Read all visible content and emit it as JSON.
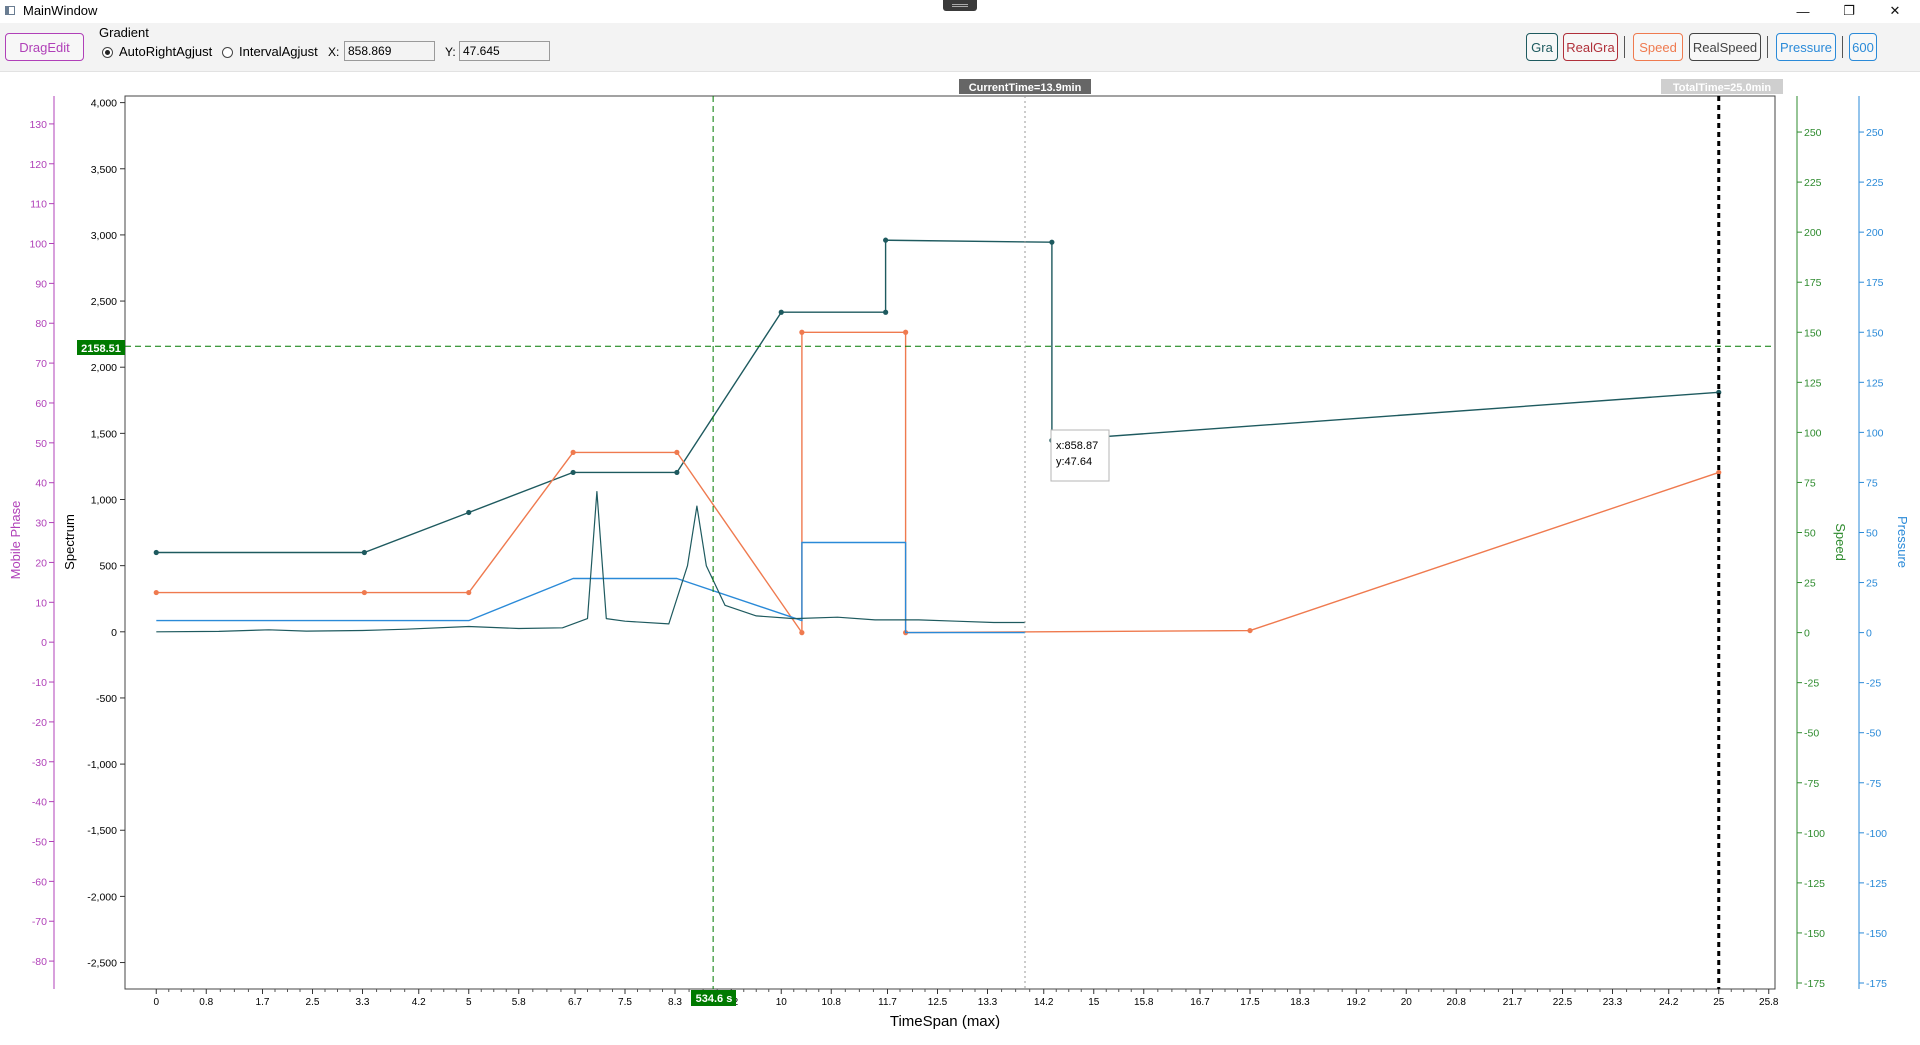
{
  "window": {
    "title": "MainWindow",
    "controls": {
      "minimize": "—",
      "maximize": "❐",
      "close": "✕"
    }
  },
  "toolbar": {
    "drag_edit": "DragEdit",
    "gradient_label": "Gradient",
    "auto_right_label": "AutoRightAgjust",
    "interval_label": "IntervalAgjust",
    "selected_mode": "AutoRightAgjust",
    "x_label": "X:",
    "x_value": "858.869",
    "y_label": "Y:",
    "y_value": "47.645",
    "right_buttons": {
      "gra": "Gra",
      "realgra": "RealGra",
      "speed": "Speed",
      "realspeed": "RealSpeed",
      "pressure": "Pressure",
      "n600": "600"
    }
  },
  "colors": {
    "gra": "#1e5a5f",
    "realgra": "#b0303a",
    "speed": "#ef7a4f",
    "realspeed": "#444444",
    "pressure": "#2a8ad8",
    "mobile_phase_axis": "#b040b8",
    "speed_axis": "#2e8b2e",
    "marker_green": "#007a00"
  },
  "chart": {
    "current_time_label": "CurrentTime=13.9min",
    "total_time_label": "TotalTime=25.0min",
    "y_marker_label": "2158.51",
    "x_marker_label": "534.6 s",
    "tooltip_x": "x:858.87",
    "tooltip_y": "y:47.64",
    "xlabel": "TimeSpan (max)",
    "axis_titles": {
      "mobile_phase": "Mobile Phase",
      "spectrum": "Spectrum",
      "speed": "Speed",
      "pressure": "Pressure"
    }
  },
  "chart_data": {
    "type": "line",
    "x_ticks": [
      "0",
      "0.8",
      "1.7",
      "2.5",
      "3.3",
      "4.2",
      "5",
      "5.8",
      "6.7",
      "7.5",
      "8.3",
      "9.2",
      "10",
      "10.8",
      "11.7",
      "12.5",
      "13.3",
      "14.2",
      "15",
      "15.8",
      "16.7",
      "17.5",
      "18.3",
      "19.2",
      "20",
      "20.8",
      "21.7",
      "22.5",
      "23.3",
      "24.2",
      "25",
      "25.8"
    ],
    "xlim": [
      -0.5,
      25.9
    ],
    "spectrum_axis": {
      "ylim": [
        -2700,
        4050
      ],
      "ticks": [
        "4,000",
        "3,500",
        "3,000",
        "2,500",
        "2,000",
        "1,500",
        "1,000",
        "500",
        "0",
        "-500",
        "-1,000",
        "-1,500",
        "-2,000",
        "-2,500"
      ]
    },
    "mobile_phase_axis": {
      "ylim": [
        -87,
        137
      ],
      "ticks": [
        "130",
        "120",
        "110",
        "100",
        "90",
        "80",
        "70",
        "60",
        "50",
        "40",
        "30",
        "20",
        "10",
        "0",
        "-10",
        "-20",
        "-30",
        "-40",
        "-50",
        "-60",
        "-70",
        "-80"
      ]
    },
    "speed_axis": {
      "ylim": [
        -178,
        268
      ],
      "ticks": [
        "250",
        "225",
        "200",
        "175",
        "150",
        "125",
        "100",
        "75",
        "50",
        "25",
        "0",
        "-25",
        "-50",
        "-75",
        "-100",
        "-125",
        "-150",
        "-175"
      ]
    },
    "pressure_axis": {
      "ylim": [
        -178,
        268
      ],
      "ticks": [
        "250",
        "225",
        "200",
        "175",
        "150",
        "125",
        "100",
        "75",
        "50",
        "25",
        "0",
        "-25",
        "-50",
        "-75",
        "-100",
        "-125",
        "-150",
        "-175"
      ]
    },
    "current_time": 13.9,
    "total_time": 25.0,
    "x_marker": 8.91,
    "y_marker": 2158.51,
    "series": [
      {
        "name": "Gra",
        "axis": "speed",
        "points": [
          [
            0,
            40
          ],
          [
            3.33,
            40
          ],
          [
            5,
            60
          ],
          [
            6.67,
            80
          ],
          [
            8.33,
            80
          ],
          [
            10,
            160
          ],
          [
            11.67,
            160
          ],
          [
            11.67,
            196
          ],
          [
            14.33,
            195
          ],
          [
            14.33,
            96
          ],
          [
            25,
            120
          ]
        ]
      },
      {
        "name": "Speed",
        "axis": "speed",
        "points": [
          [
            0,
            20
          ],
          [
            3.33,
            20
          ],
          [
            5,
            20
          ],
          [
            6.67,
            90
          ],
          [
            8.33,
            90
          ],
          [
            10.33,
            0
          ],
          [
            10.33,
            150
          ],
          [
            11.99,
            150
          ],
          [
            11.99,
            0
          ],
          [
            17.5,
            1
          ],
          [
            25,
            80
          ]
        ]
      },
      {
        "name": "Pressure",
        "axis": "pressure",
        "points": [
          [
            0,
            6
          ],
          [
            5,
            6
          ],
          [
            6.67,
            27
          ],
          [
            8.33,
            27
          ],
          [
            10.33,
            6
          ],
          [
            10.33,
            45
          ],
          [
            11.99,
            45
          ],
          [
            11.99,
            0
          ],
          [
            13.9,
            0
          ]
        ]
      },
      {
        "name": "Spectrum",
        "axis": "spectrum",
        "points": [
          [
            0,
            0
          ],
          [
            1,
            3
          ],
          [
            1.8,
            15
          ],
          [
            2.4,
            5
          ],
          [
            3.3,
            10
          ],
          [
            4,
            20
          ],
          [
            5,
            40
          ],
          [
            5.8,
            25
          ],
          [
            6.5,
            30
          ],
          [
            6.9,
            100
          ],
          [
            7.05,
            1060
          ],
          [
            7.2,
            100
          ],
          [
            7.5,
            80
          ],
          [
            8.2,
            60
          ],
          [
            8.5,
            500
          ],
          [
            8.65,
            950
          ],
          [
            8.8,
            500
          ],
          [
            9.1,
            200
          ],
          [
            9.6,
            120
          ],
          [
            10.2,
            100
          ],
          [
            10.9,
            110
          ],
          [
            11.5,
            90
          ],
          [
            12.2,
            90
          ],
          [
            12.8,
            80
          ],
          [
            13.4,
            70
          ],
          [
            13.9,
            70
          ]
        ]
      }
    ]
  }
}
